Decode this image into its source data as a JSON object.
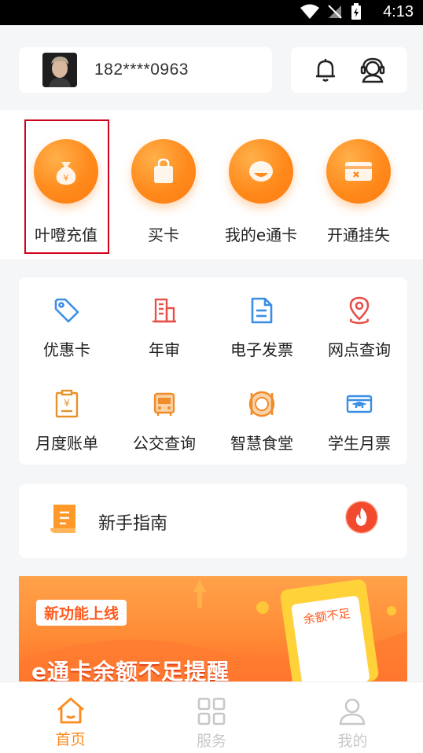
{
  "status": {
    "time": "4:13"
  },
  "user": {
    "phone": "182****0963"
  },
  "header_icons": [
    "bell-icon",
    "customer-service-icon"
  ],
  "quick_actions": [
    {
      "label": "叶噔充值",
      "icon": "money-bag-icon"
    },
    {
      "label": "买卡",
      "icon": "shopping-bag-icon"
    },
    {
      "label": "我的e通卡",
      "icon": "card-face-icon"
    },
    {
      "label": "开通挂失",
      "icon": "card-cancel-icon"
    }
  ],
  "services": [
    {
      "label": "优惠卡",
      "icon": "tag-icon",
      "color": "#3b8ee6"
    },
    {
      "label": "年审",
      "icon": "building-icon",
      "color": "#e8504a"
    },
    {
      "label": "电子发票",
      "icon": "document-icon",
      "color": "#3b8ee6"
    },
    {
      "label": "网点查询",
      "icon": "location-pin-icon",
      "color": "#e8504a"
    },
    {
      "label": "月度账单",
      "icon": "bill-icon",
      "color": "#e8922a"
    },
    {
      "label": "公交查询",
      "icon": "bus-icon",
      "color": "#f08c2a"
    },
    {
      "label": "智慧食堂",
      "icon": "dining-icon",
      "color": "#f08c2a"
    },
    {
      "label": "学生月票",
      "icon": "student-card-icon",
      "color": "#3b8ee6"
    }
  ],
  "guide": {
    "label": "新手指南"
  },
  "banner": {
    "tag": "新功能上线",
    "title": "e通卡余额不足提醒",
    "phone_text": "余额不足"
  },
  "tabs": [
    {
      "label": "首页",
      "icon": "home-icon",
      "active": true
    },
    {
      "label": "服务",
      "icon": "grid-icon",
      "active": false
    },
    {
      "label": "我的",
      "icon": "user-icon",
      "active": false
    }
  ],
  "colors": {
    "accent": "#ff8a1c",
    "highlight_border": "#d0021b"
  }
}
